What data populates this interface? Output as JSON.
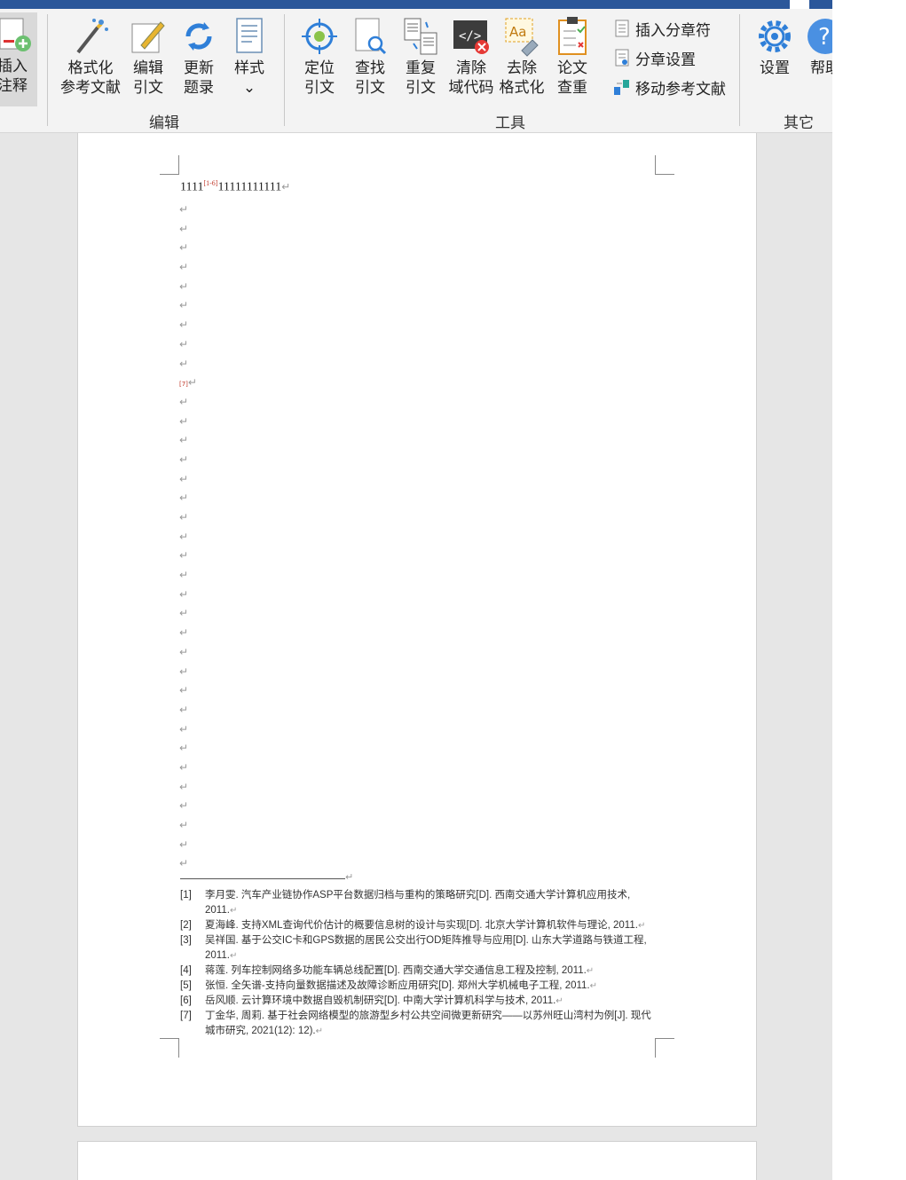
{
  "ribbon": {
    "insert_note": {
      "label": "插入\n注释"
    },
    "format_refs": {
      "label": "格式化\n参考文献"
    },
    "edit_cite": {
      "label": "编辑\n引文"
    },
    "update_toc": {
      "label": "更新\n题录"
    },
    "style": {
      "label": "样式\n⌄"
    },
    "locate_cite": {
      "label": "定位\n引文"
    },
    "find_cite": {
      "label": "查找\n引文"
    },
    "dup_cite": {
      "label": "重复\n引文"
    },
    "clear_field": {
      "label": "清除\n域代码"
    },
    "remove_format": {
      "label": "去除\n格式化"
    },
    "check_dup": {
      "label": "论文\n查重"
    },
    "insert_section": {
      "label": "插入分章符"
    },
    "section_settings": {
      "label": "分章设置"
    },
    "move_refs": {
      "label": "移动参考文献"
    },
    "settings": {
      "label": "设置"
    },
    "help": {
      "label": "帮助"
    },
    "groups": {
      "edit": "编辑",
      "tools": "工具",
      "other": "其它"
    }
  },
  "document": {
    "line1_before": "1111",
    "line1_sup": "[1-6]",
    "line1_after": "11111111111",
    "para_mark": "↵",
    "marker7": "[7]",
    "references": [
      {
        "num": "[1]",
        "text": "李月雯. 汽车产业链协作ASP平台数据归档与重构的策略研究[D]. 西南交通大学计算机应用技术, 2011."
      },
      {
        "num": "[2]",
        "text": "夏海峰. 支持XML查询代价估计的概要信息树的设计与实现[D]. 北京大学计算机软件与理论, 2011."
      },
      {
        "num": "[3]",
        "text": "吴祥国. 基于公交IC卡和GPS数据的居民公交出行OD矩阵推导与应用[D]. 山东大学道路与铁道工程, 2011."
      },
      {
        "num": "[4]",
        "text": "蒋莲. 列车控制网络多功能车辆总线配置[D]. 西南交通大学交通信息工程及控制, 2011."
      },
      {
        "num": "[5]",
        "text": "张恒. 全矢谱-支持向量数据描述及故障诊断应用研究[D]. 郑州大学机械电子工程, 2011."
      },
      {
        "num": "[6]",
        "text": "岳风顺. 云计算环境中数据自毁机制研究[D]. 中南大学计算机科学与技术, 2011."
      },
      {
        "num": "[7]",
        "text": "丁金华, 周莉. 基于社会网络模型的旅游型乡村公共空间微更新研究——以苏州旺山湾村为例[J]. 现代城市研究, 2021(12): 12)."
      }
    ]
  }
}
